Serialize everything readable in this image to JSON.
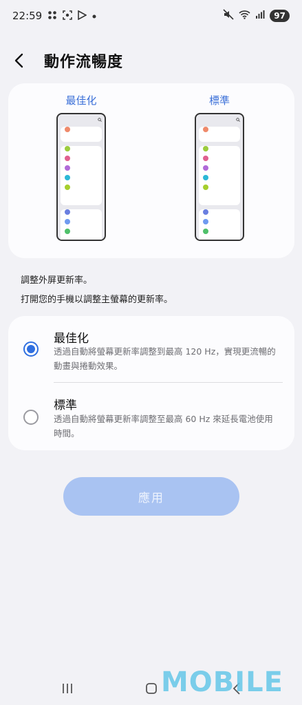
{
  "status_bar": {
    "time": "22:59",
    "battery": "97",
    "icons": [
      "apps-icon",
      "screenshot-icon",
      "play-store-icon",
      "dot-icon",
      "mute-icon",
      "wifi-icon",
      "signal-icon"
    ]
  },
  "header": {
    "title": "動作流暢度"
  },
  "preview": {
    "optimized_label": "最佳化",
    "standard_label": "標準",
    "optimized_dots": [
      "#ef8a6b",
      "#9ccc3d",
      "#e0608f",
      "#b06ad8",
      "#2bb8d6",
      "#a6cf2d",
      "#6a7fe0",
      "#6f9af0",
      "#4fc06a"
    ],
    "standard_dots": [
      "#ef8a6b",
      "#9ccc3d",
      "#e0608f",
      "#b06ad8",
      "#2bb8d6",
      "#a6cf2d",
      "#6a7fe0",
      "#6f9af0",
      "#4fc06a"
    ]
  },
  "description": {
    "line1": "調整外屏更新率。",
    "line2": "打開您的手機以調整主螢幕的更新率。"
  },
  "options": [
    {
      "title": "最佳化",
      "desc": "透過自動將螢幕更新率調整到最高 120 Hz，實現更流暢的動畫與捲動效果。",
      "selected": true
    },
    {
      "title": "標準",
      "desc": "透過自動將螢幕更新率調整至最高 60 Hz 來延長電池使用時間。",
      "selected": false
    }
  ],
  "apply_button": {
    "label": "應用"
  },
  "watermark": {
    "text": "MOBILE"
  },
  "colors": {
    "accent": "#2f6fe0",
    "apply_disabled": "#a9c3f2",
    "label_blue": "#3a6fd8"
  }
}
